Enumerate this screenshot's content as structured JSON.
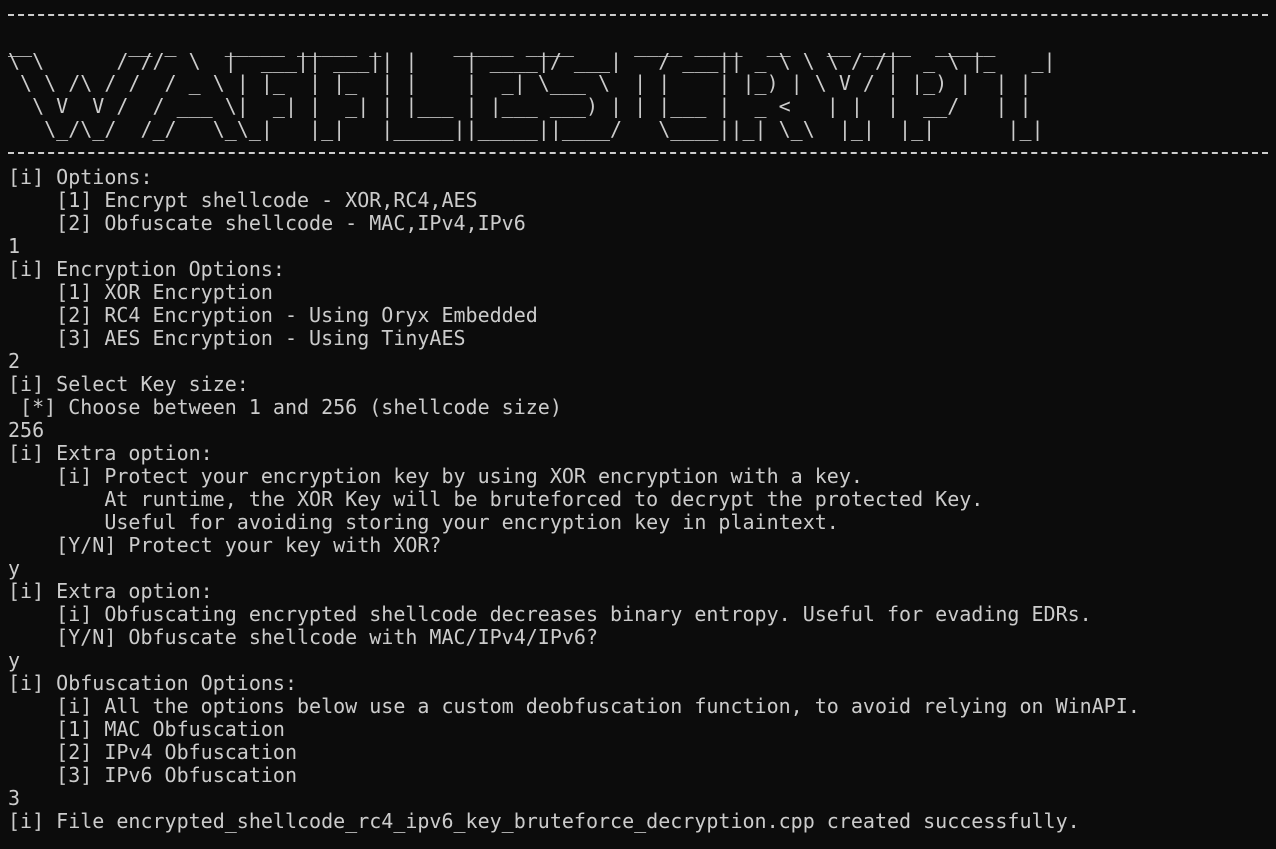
{
  "banner": {
    "ascii_rows": [
      "__        __ _    _____ _____ _      _____ ____     ____ ____  __   __ ____  _____",
      "\\ \\      / //  \\  |  ___|| ___|| |    | ____|/ ___|   / ___|| _ \\ \\ \\ / /|  _ \\ |_   _|",
      " \\ \\ /\\ / /  / _ \\ | |_  | |_  | |    |  _| \\___ \\  | |    | |_) | \\ V / | |_) |  | |",
      "  \\ V  V /  / ___ \\|  _| |  _| | |___ | |___ ___) | | |___ |  _ <   | |  |  __/   | |",
      "   \\_/\\_/  /_/   \\_\\_|   |_|   |_____||_____||____/   \\____||_| \\_\\  |_|  |_|      |_|"
    ]
  },
  "lines": [
    "[i] Options:",
    "    [1] Encrypt shellcode - XOR,RC4,AES",
    "    [2] Obfuscate shellcode - MAC,IPv4,IPv6",
    "1",
    "[i] Encryption Options:",
    "    [1] XOR Encryption",
    "    [2] RC4 Encryption - Using Oryx Embedded",
    "    [3] AES Encryption - Using TinyAES",
    "2",
    "[i] Select Key size:",
    " [*] Choose between 1 and 256 (shellcode size)",
    "256",
    "[i] Extra option:",
    "    [i] Protect your encryption key by using XOR encryption with a key.",
    "        At runtime, the XOR Key will be bruteforced to decrypt the protected Key.",
    "        Useful for avoiding storing your encryption key in plaintext.",
    "    [Y/N] Protect your key with XOR?",
    "y",
    "[i] Extra option:",
    "    [i] Obfuscating encrypted shellcode decreases binary entropy. Useful for evading EDRs.",
    "    [Y/N] Obfuscate shellcode with MAC/IPv4/IPv6?",
    "y",
    "[i] Obfuscation Options:",
    "    [i] All the options below use a custom deobfuscation function, to avoid relying on WinAPI.",
    "    [1] MAC Obfuscation",
    "    [2] IPv4 Obfuscation",
    "    [3] IPv6 Obfuscation",
    "3",
    "[i] File encrypted_shellcode_rc4_ipv6_key_bruteforce_decryption.cpp created successfully."
  ],
  "colors": {
    "background": "#0c0c0c",
    "foreground": "#cccccc"
  }
}
